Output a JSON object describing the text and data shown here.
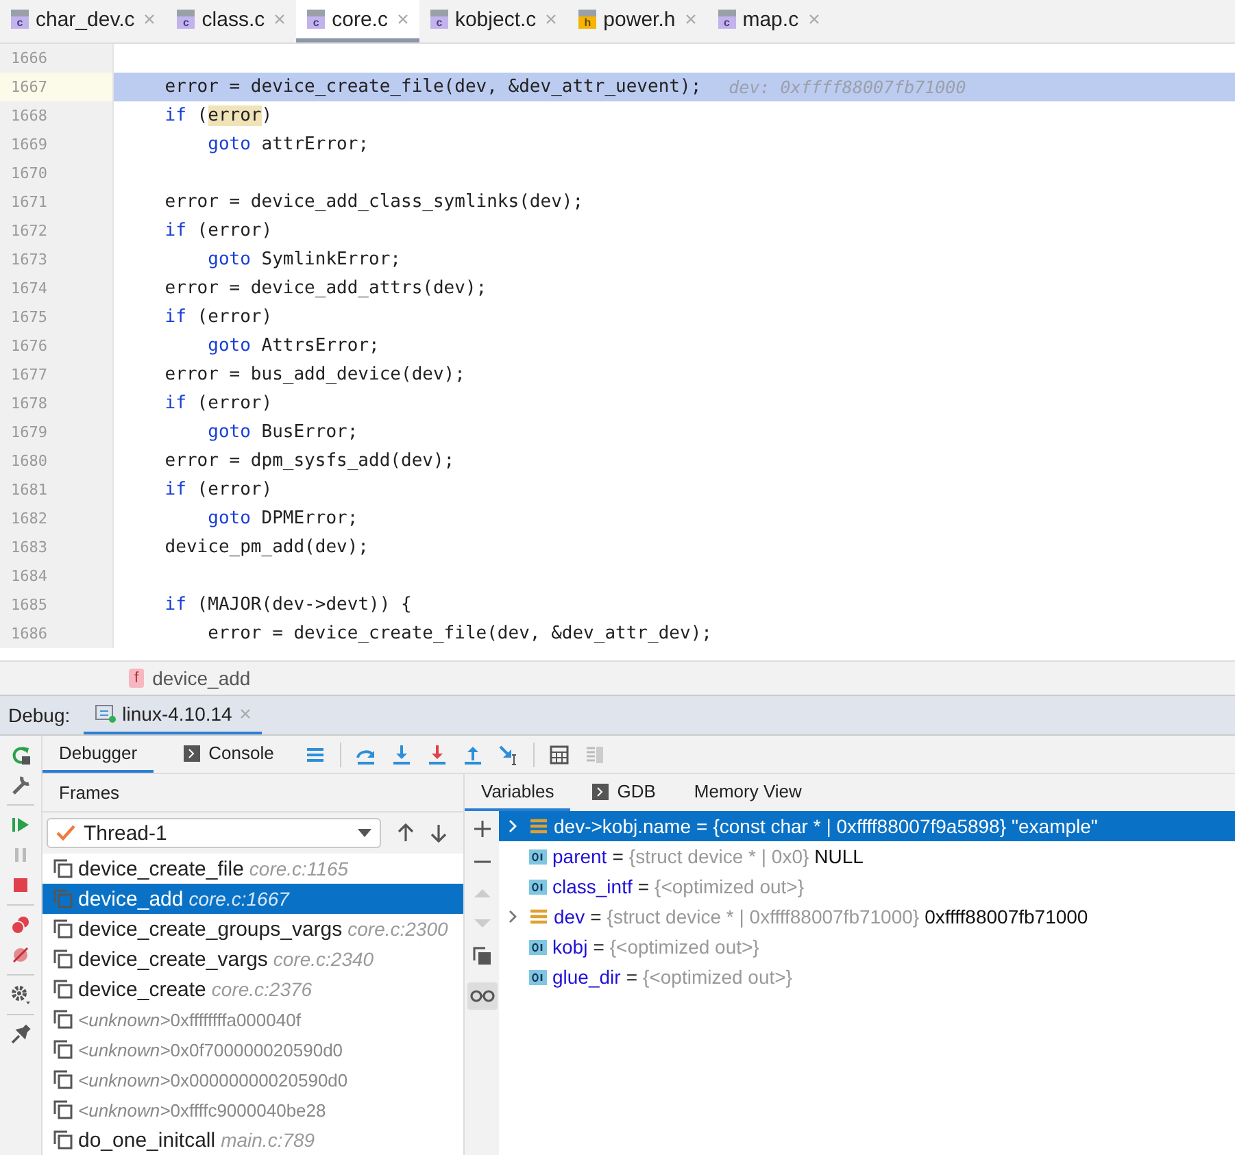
{
  "file_tabs": [
    {
      "label": "char_dev.c",
      "file_type": "c",
      "selected": false
    },
    {
      "label": "class.c",
      "file_type": "c",
      "selected": false
    },
    {
      "label": "core.c",
      "file_type": "c",
      "selected": true
    },
    {
      "label": "kobject.c",
      "file_type": "c",
      "selected": false
    },
    {
      "label": "power.h",
      "file_type": "h",
      "selected": false
    },
    {
      "label": "map.c",
      "file_type": "c",
      "selected": false
    }
  ],
  "editor": {
    "lines": [
      {
        "number": "1666",
        "selected": false
      },
      {
        "number": "1667",
        "selected": true,
        "segments": [
          {
            "kind": "plain",
            "text": "    error = device_create_file(dev, &dev_attr_uevent);"
          }
        ],
        "hint": "dev: 0xffff88007fb71000"
      },
      {
        "number": "1668",
        "selected": false,
        "segments": [
          {
            "kind": "keyword",
            "text": "    if"
          },
          {
            "kind": "plain",
            "text": " ("
          },
          {
            "kind": "match",
            "text": "error"
          },
          {
            "kind": "plain",
            "text": ")"
          }
        ]
      },
      {
        "number": "1669",
        "selected": false,
        "segments": [
          {
            "kind": "keyword",
            "text": "        goto"
          },
          {
            "kind": "plain",
            "text": " attrError;"
          }
        ]
      },
      {
        "number": "1670",
        "selected": false
      },
      {
        "number": "1671",
        "selected": false,
        "segments": [
          {
            "kind": "plain",
            "text": "    error = device_add_class_symlinks(dev);"
          }
        ]
      },
      {
        "number": "1672",
        "selected": false,
        "segments": [
          {
            "kind": "keyword",
            "text": "    if"
          },
          {
            "kind": "plain",
            "text": " (error)"
          }
        ]
      },
      {
        "number": "1673",
        "selected": false,
        "segments": [
          {
            "kind": "keyword",
            "text": "        goto"
          },
          {
            "kind": "plain",
            "text": " SymlinkError;"
          }
        ]
      },
      {
        "number": "1674",
        "selected": false,
        "segments": [
          {
            "kind": "plain",
            "text": "    error = device_add_attrs(dev);"
          }
        ]
      },
      {
        "number": "1675",
        "selected": false,
        "segments": [
          {
            "kind": "keyword",
            "text": "    if"
          },
          {
            "kind": "plain",
            "text": " (error)"
          }
        ]
      },
      {
        "number": "1676",
        "selected": false,
        "segments": [
          {
            "kind": "keyword",
            "text": "        goto"
          },
          {
            "kind": "plain",
            "text": " AttrsError;"
          }
        ]
      },
      {
        "number": "1677",
        "selected": false,
        "segments": [
          {
            "kind": "plain",
            "text": "    error = bus_add_device(dev);"
          }
        ]
      },
      {
        "number": "1678",
        "selected": false,
        "segments": [
          {
            "kind": "keyword",
            "text": "    if"
          },
          {
            "kind": "plain",
            "text": " (error)"
          }
        ]
      },
      {
        "number": "1679",
        "selected": false,
        "segments": [
          {
            "kind": "keyword",
            "text": "        goto"
          },
          {
            "kind": "plain",
            "text": " BusError;"
          }
        ]
      },
      {
        "number": "1680",
        "selected": false,
        "segments": [
          {
            "kind": "plain",
            "text": "    error = dpm_sysfs_add(dev);"
          }
        ]
      },
      {
        "number": "1681",
        "selected": false,
        "segments": [
          {
            "kind": "keyword",
            "text": "    if"
          },
          {
            "kind": "plain",
            "text": " (error)"
          }
        ]
      },
      {
        "number": "1682",
        "selected": false,
        "segments": [
          {
            "kind": "keyword",
            "text": "        goto"
          },
          {
            "kind": "plain",
            "text": " DPMError;"
          }
        ]
      },
      {
        "number": "1683",
        "selected": false,
        "segments": [
          {
            "kind": "plain",
            "text": "    device_pm_add(dev);"
          }
        ]
      },
      {
        "number": "1684",
        "selected": false
      },
      {
        "number": "1685",
        "selected": false,
        "segments": [
          {
            "kind": "keyword",
            "text": "    if"
          },
          {
            "kind": "plain",
            "text": " (MAJOR(dev->devt)) {"
          }
        ]
      },
      {
        "number": "1686",
        "selected": false,
        "segments": [
          {
            "kind": "plain",
            "text": "        error = device_create_file(dev, &dev_attr_dev);"
          }
        ]
      }
    ],
    "breadcrumb": {
      "badge": "f",
      "label": "device_add"
    }
  },
  "debug": {
    "label": "Debug:",
    "session": "linux-4.10.14",
    "tabs": [
      {
        "label": "Debugger",
        "selected": true
      },
      {
        "label": "Console",
        "selected": false
      }
    ],
    "frames": {
      "title": "Frames",
      "thread": "Thread-1",
      "items": [
        {
          "kind": "known",
          "name": "device_create_file",
          "location": "core.c:1165",
          "selected": false
        },
        {
          "kind": "known",
          "name": "device_add",
          "location": "core.c:1667",
          "selected": true
        },
        {
          "kind": "known",
          "name": "device_create_groups_vargs",
          "location": "core.c:2300",
          "selected": false
        },
        {
          "kind": "known",
          "name": "device_create_vargs",
          "location": "core.c:2340",
          "selected": false
        },
        {
          "kind": "known",
          "name": "device_create",
          "location": "core.c:2376",
          "selected": false
        },
        {
          "kind": "unknown",
          "name": "<unknown>",
          "location": "0xffffffffa000040f",
          "selected": false
        },
        {
          "kind": "unknown",
          "name": "<unknown>",
          "location": "0x0f700000020590d0",
          "selected": false
        },
        {
          "kind": "unknown",
          "name": "<unknown>",
          "location": "0x00000000020590d0",
          "selected": false
        },
        {
          "kind": "unknown",
          "name": "<unknown>",
          "location": "0xffffc9000040be28",
          "selected": false
        },
        {
          "kind": "known",
          "name": "do_one_initcall",
          "location": "main.c:789",
          "selected": false
        }
      ]
    },
    "variable_tabs": [
      {
        "label": "Variables",
        "selected": true
      },
      {
        "label": "GDB",
        "selected": false
      },
      {
        "label": "Memory View",
        "selected": false
      }
    ],
    "variables": [
      {
        "kind": "struct",
        "name": "dev->kobj.name",
        "operator": "=",
        "type": "{const char * | 0xffff88007f9a5898}",
        "value": "\"example\"",
        "expanded": false,
        "selected": true
      },
      {
        "kind": "primitive",
        "name": "parent",
        "operator": "=",
        "type": "{struct device * | 0x0}",
        "value": "NULL",
        "selected": false
      },
      {
        "kind": "primitive",
        "name": "class_intf",
        "operator": "=",
        "type": "{<optimized out>}",
        "selected": false
      },
      {
        "kind": "struct",
        "name": "dev",
        "operator": "=",
        "type": "{struct device * | 0xffff88007fb71000}",
        "value": "0xffff88007fb71000",
        "expanded": false,
        "selected": false
      },
      {
        "kind": "primitive",
        "name": "kobj",
        "operator": "=",
        "type": "{<optimized out>}",
        "selected": false
      },
      {
        "kind": "primitive",
        "name": "glue_dir",
        "operator": "=",
        "type": "{<optimized out>}",
        "selected": false
      }
    ]
  }
}
